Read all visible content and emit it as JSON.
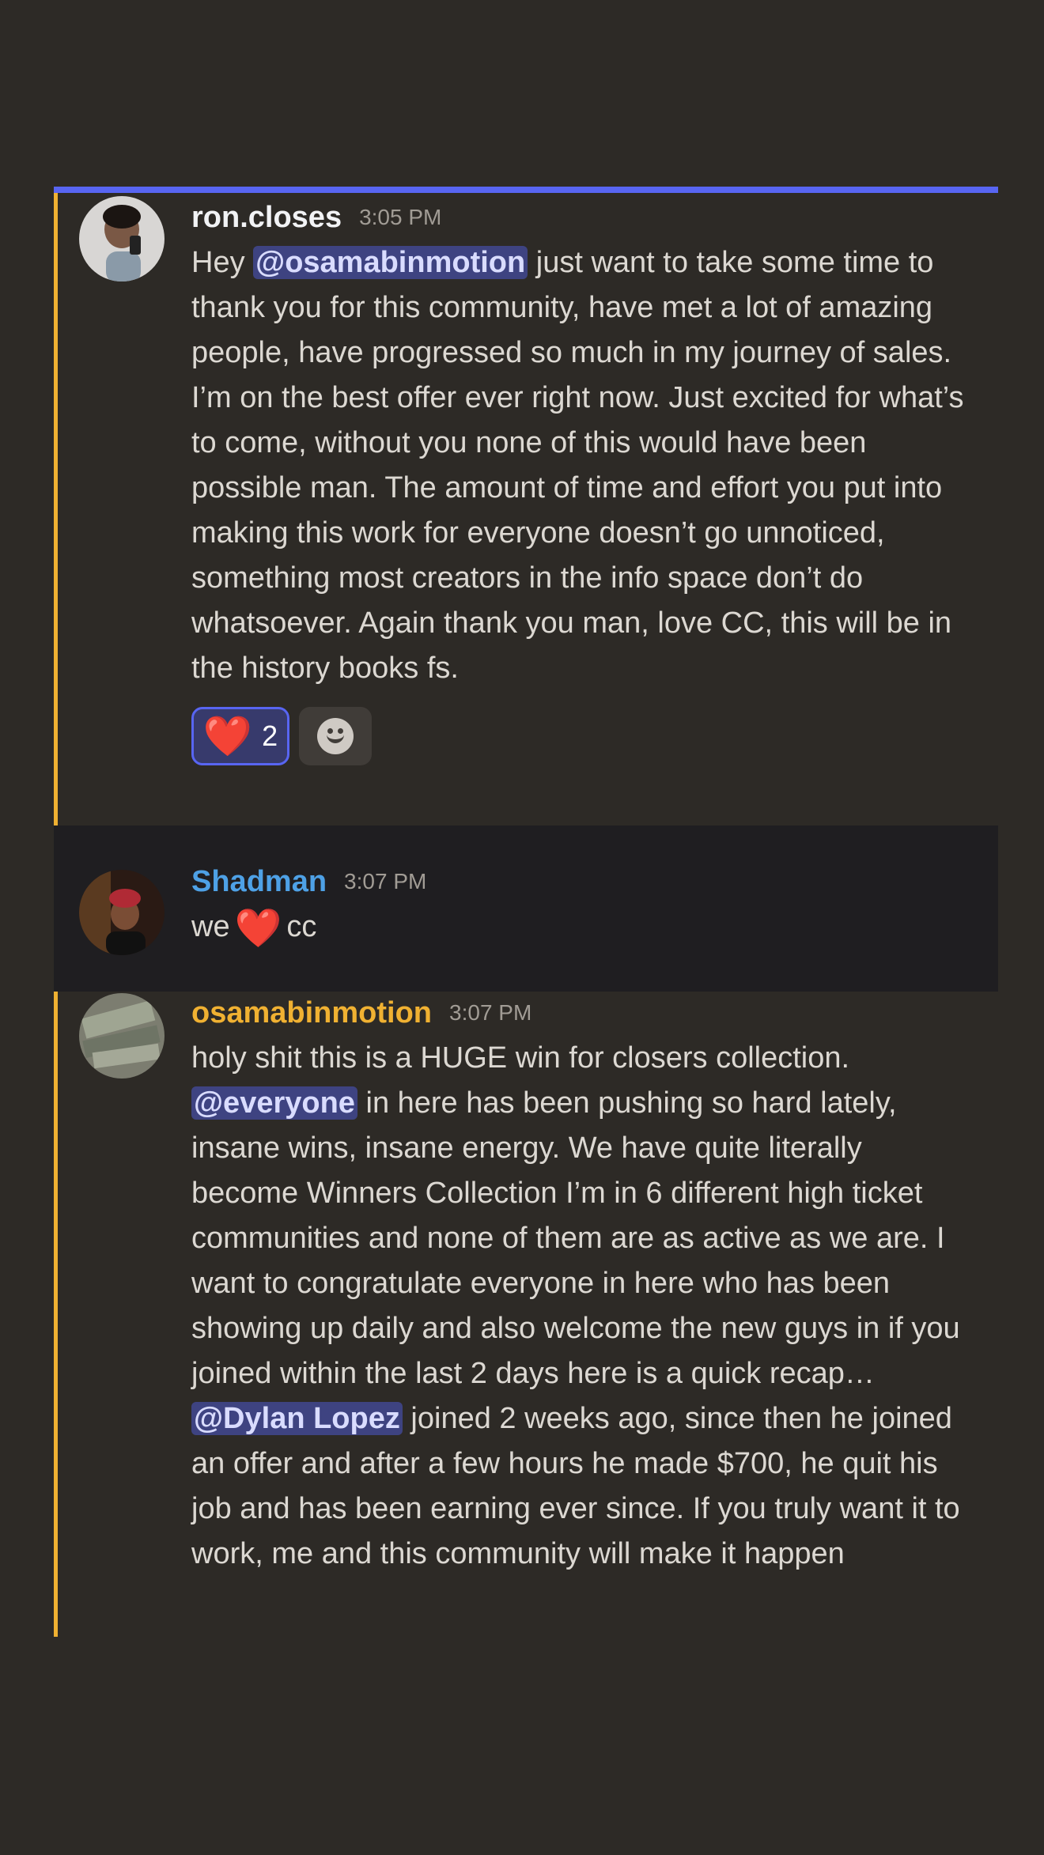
{
  "messages": [
    {
      "author": "ron.closes",
      "author_color": "#f2f3f5",
      "time": "3:05 PM",
      "text_before_mention": "Hey ",
      "mention": "@osamabinmotion",
      "text_after_mention": " just want to take some time to thank you for this community, have met a lot of amazing people, have progressed so much in my journey of sales. I’m on the best offer ever right now. Just excited for what’s to come, without you none of this would have been possible man. The amount of time and effort you put into making this work for everyone doesn’t go unnoticed, something most creators in the info space don’t do whatsoever. Again thank you man, love CC, this will be in the history books fs.",
      "reactions": [
        {
          "emoji": "❤️",
          "count": "2",
          "selected": true
        },
        {
          "emoji": "add-reaction-icon",
          "count": "",
          "selected": false
        }
      ]
    },
    {
      "author": "Shadman",
      "author_color": "#4ea1e6",
      "time": "3:07 PM",
      "text_before_emoji": "we",
      "emoji": "❤️",
      "text_after_emoji": "cc"
    },
    {
      "author": "osamabinmotion",
      "author_color": "#f0b132",
      "time": "3:07 PM",
      "text_line1": "holy shit this is a HUGE win for closers collection.",
      "mention1": "@everyone",
      "text_mid": " in here has been pushing so hard lately, insane wins, insane energy. We have quite literally become Winners Collection I’m in 6 different high ticket communities and none of them are as active as we are. I want to congratulate everyone in here who has been showing up daily and also welcome the new guys in if you joined within the last 2 days here is a quick recap… ",
      "mention2": "@Dylan Lopez",
      "text_end": " joined 2 weeks ago, since then he joined an offer and after a few hours he made $700, he quit his job and has been earning ever since. If you truly want it to work, me and this community will make it happen"
    }
  ],
  "colors": {
    "background": "#2d2a26",
    "mention_bg": "#3e4381",
    "highlight_bar": "#f0b132",
    "top_line": "#5865f2"
  }
}
